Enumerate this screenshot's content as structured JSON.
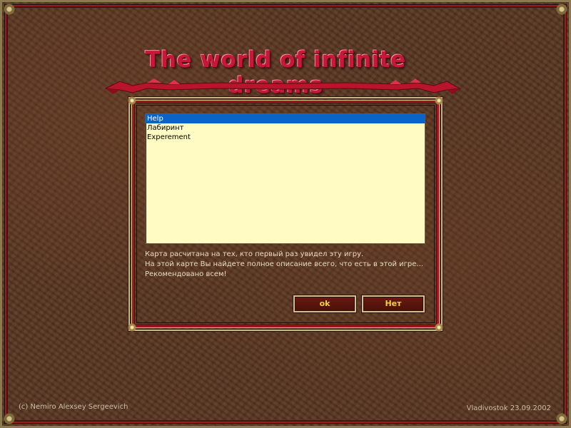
{
  "window": {
    "title": "The world of infinite dreams"
  },
  "list": {
    "items": [
      {
        "label": "Help",
        "selected": true
      },
      {
        "label": "Лабиринт",
        "selected": false
      },
      {
        "label": "Experement",
        "selected": false
      }
    ]
  },
  "description": {
    "lines": [
      "Карта расчитана на тех, кто первый раз увидел эту игру.",
      "На этой карте Вы найдете полное описание всего, что есть в этой игре...",
      "Рекомендовано всем!"
    ]
  },
  "buttons": {
    "ok_label": "ok",
    "no_label": "Нет"
  },
  "footer": {
    "left": "(c) Nemiro Alexsey Sergeevich",
    "right": "Vladivostok 23.09.2002"
  },
  "colors": {
    "title": "#c8183a",
    "frame_red": "#a0151d",
    "frame_gold": "#c7b98a",
    "list_bg": "#fffbc2",
    "selection": "#0a64c8",
    "button_text": "#f2d23c",
    "background": "#5a3722"
  }
}
